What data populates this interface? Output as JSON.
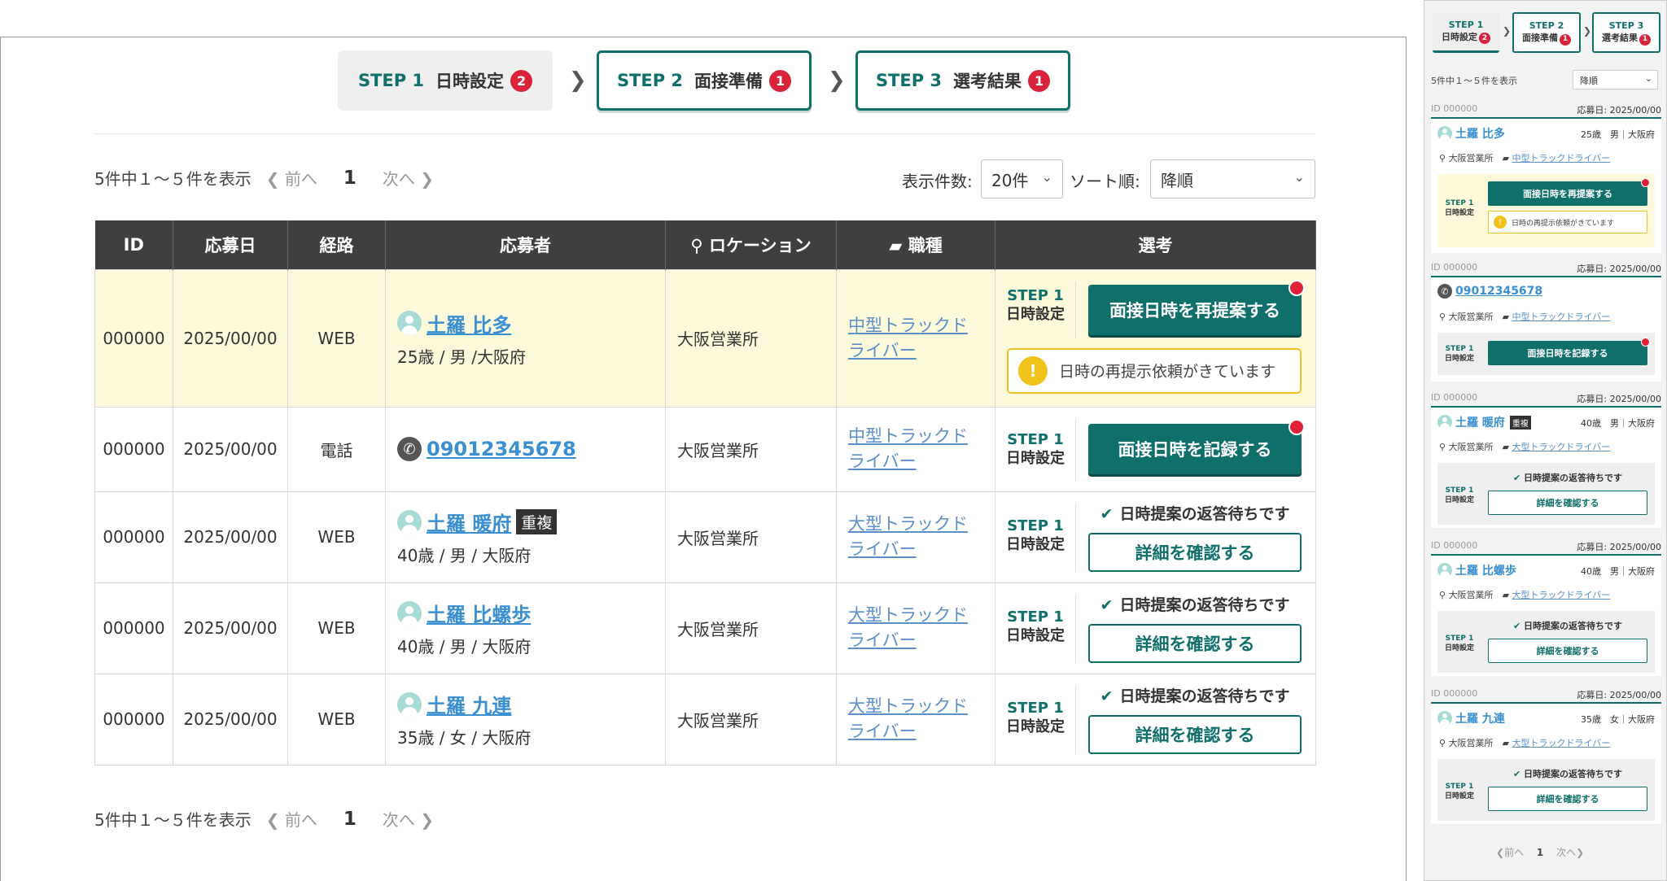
{
  "steps": [
    {
      "num": "STEP 1",
      "title": "日時設定",
      "badge": "2"
    },
    {
      "num": "STEP 2",
      "title": "面接準備",
      "badge": "1"
    },
    {
      "num": "STEP 3",
      "title": "選考結果",
      "badge": "1"
    }
  ],
  "pager": {
    "summary": "5件中１～５件を表示",
    "prev": "前へ",
    "page": "1",
    "next": "次へ"
  },
  "controls": {
    "per_page_label": "表示件数:",
    "per_page_value": "20件",
    "sort_label": "ソート順:",
    "sort_value": "降順"
  },
  "table": {
    "headers": [
      "ID",
      "応募日",
      "経路",
      "応募者",
      "ロケーション",
      "職種",
      "選考"
    ],
    "rows": [
      {
        "id": "000000",
        "date": "2025/00/00",
        "route": "WEB",
        "name": "土羅 比多",
        "info": "25歳 / 男 /大阪府",
        "location": "大阪営業所",
        "job_line1": "中型トラックド",
        "job_line2": "ライバー",
        "step_num": "STEP 1",
        "step_title": "日時設定",
        "action": "面接日時を再提案する",
        "warning": "日時の再提示依頼がきています"
      },
      {
        "id": "000000",
        "date": "2025/00/00",
        "route": "電話",
        "phone": "09012345678",
        "location": "大阪営業所",
        "job_line1": "中型トラックド",
        "job_line2": "ライバー",
        "step_num": "STEP 1",
        "step_title": "日時設定",
        "action": "面接日時を記録する"
      },
      {
        "id": "000000",
        "date": "2025/00/00",
        "route": "WEB",
        "name": "土羅 暖府",
        "dup": "重複",
        "info": "40歳 / 男 / 大阪府",
        "location": "大阪営業所",
        "job_line1": "大型トラックド",
        "job_line2": "ライバー",
        "step_num": "STEP 1",
        "step_title": "日時設定",
        "wait": "日時提案の返答待ちです",
        "detail": "詳細を確認する"
      },
      {
        "id": "000000",
        "date": "2025/00/00",
        "route": "WEB",
        "name": "土羅 比螺歩",
        "info": "40歳 / 男 / 大阪府",
        "location": "大阪営業所",
        "job_line1": "大型トラックド",
        "job_line2": "ライバー",
        "step_num": "STEP 1",
        "step_title": "日時設定",
        "wait": "日時提案の返答待ちです",
        "detail": "詳細を確認する"
      },
      {
        "id": "000000",
        "date": "2025/00/00",
        "route": "WEB",
        "name": "土羅 九連",
        "info": "35歳 / 女 / 大阪府",
        "location": "大阪営業所",
        "job_line1": "大型トラックド",
        "job_line2": "ライバー",
        "step_num": "STEP 1",
        "step_title": "日時設定",
        "wait": "日時提案の返答待ちです",
        "detail": "詳細を確認する"
      }
    ]
  },
  "mobile": {
    "summary": "5件中１～５件を表示",
    "sort_value": "降順",
    "pager": {
      "prev": "前へ",
      "page": "1",
      "next": "次へ"
    },
    "cards": [
      {
        "id": "ID 000000",
        "date": "応募日: 2025/00/00",
        "name": "土羅 比多",
        "age": "25歳",
        "sex": "男",
        "pref": "大阪府",
        "location": "大阪営業所",
        "job": "中型トラックドライバー",
        "action": "面接日時を再提案する",
        "warning": "日時の再提示依頼がきています"
      },
      {
        "id": "ID 000000",
        "date": "応募日: 2025/00/00",
        "phone": "09012345678",
        "location": "大阪営業所",
        "job": "中型トラックドライバー",
        "action": "面接日時を記録する"
      },
      {
        "id": "ID 000000",
        "date": "応募日: 2025/00/00",
        "name": "土羅 暖府",
        "dup": "重複",
        "age": "40歳",
        "sex": "男",
        "pref": "大阪府",
        "location": "大阪営業所",
        "job": "大型トラックドライバー",
        "wait": "日時提案の返答待ちです",
        "detail": "詳細を確認する"
      },
      {
        "id": "ID 000000",
        "date": "応募日: 2025/00/00",
        "name": "土羅 比螺歩",
        "age": "40歳",
        "sex": "男",
        "pref": "大阪府",
        "location": "大阪営業所",
        "job": "大型トラックドライバー",
        "wait": "日時提案の返答待ちです",
        "detail": "詳細を確認する"
      },
      {
        "id": "ID 000000",
        "date": "応募日: 2025/00/00",
        "name": "土羅 九連",
        "age": "35歳",
        "sex": "女",
        "pref": "大阪府",
        "location": "大阪営業所",
        "job": "大型トラックドライバー",
        "wait": "日時提案の返答待ちです",
        "detail": "詳細を確認する"
      }
    ]
  }
}
